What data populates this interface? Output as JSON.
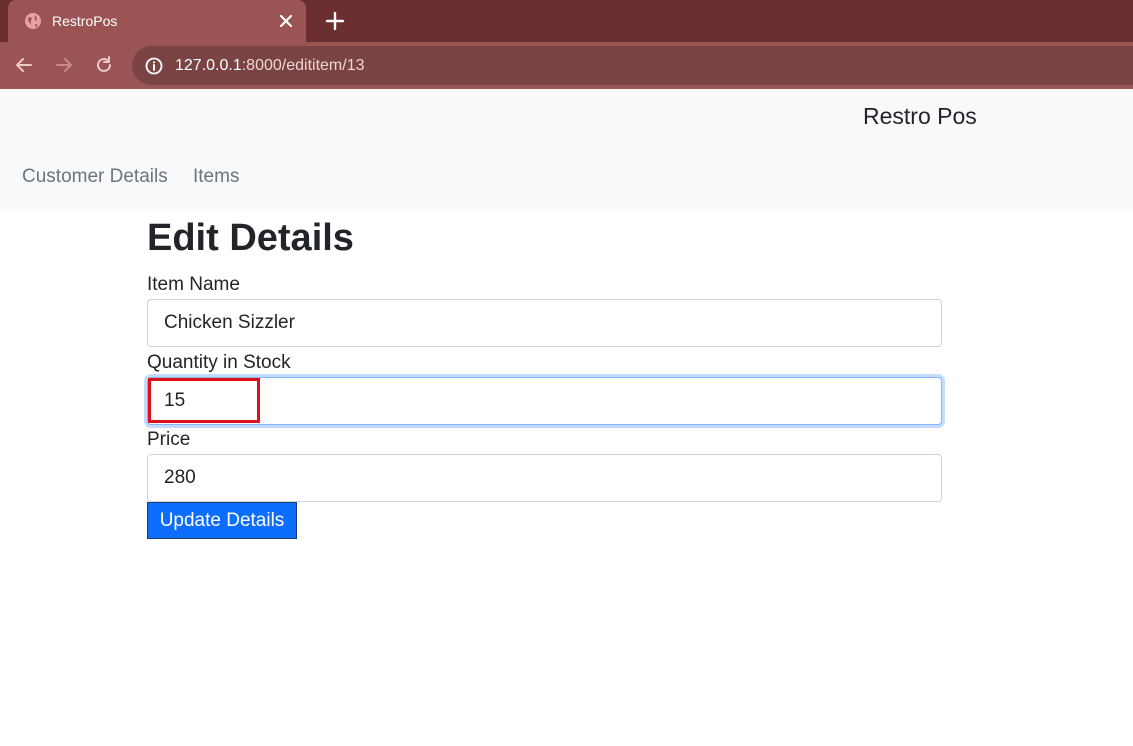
{
  "browser": {
    "tab": {
      "title": "RestroPos"
    },
    "url": {
      "host": "127.0.0.1",
      "rest": ":8000/edititem/13"
    }
  },
  "navbar": {
    "brand": "Restro Pos",
    "links": [
      {
        "label": "Customer Details"
      },
      {
        "label": "Items"
      }
    ]
  },
  "form": {
    "title": "Edit Details",
    "fields": [
      {
        "label": "Item Name",
        "value": "Chicken Sizzler"
      },
      {
        "label": "Quantity in Stock",
        "value": "15"
      },
      {
        "label": "Price",
        "value": "280"
      }
    ],
    "submit_label": "Update Details"
  },
  "colors": {
    "tabstrip": "#6b2f2f",
    "toolbar": "#9a5454",
    "primary_button": "#0d6efd",
    "highlight": "#e0101a"
  }
}
